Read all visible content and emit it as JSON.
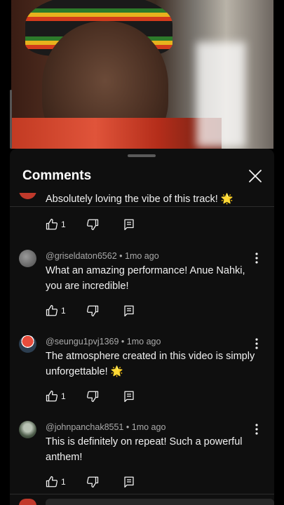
{
  "sheet": {
    "title": "Comments"
  },
  "comments": [
    {
      "author": "",
      "time": "",
      "text": "Absolutely loving the vibe of this track! 🌟",
      "likes": "1"
    },
    {
      "author": "@griseldaton6562",
      "time": "1mo ago",
      "text": "What an amazing performance! Anue Nahki, you are incredible!",
      "likes": "1"
    },
    {
      "author": "@seungu1pvj1369",
      "time": "1mo ago",
      "text": "The atmosphere created in this video is simply unforgettable! 🌟",
      "likes": "1"
    },
    {
      "author": "@johnpanchak8551",
      "time": "1mo ago",
      "text": "This is definitely on repeat! Such a powerful anthem!",
      "likes": "1"
    }
  ],
  "separator": "•",
  "icons": {
    "close": "close-icon",
    "like": "thumb-up-icon",
    "dislike": "thumb-down-icon",
    "reply": "reply-icon",
    "more": "more-vert-icon"
  },
  "colors": {
    "background": "#0f0f0f",
    "text": "#f1f1f1",
    "meta": "#aaaaaa"
  }
}
